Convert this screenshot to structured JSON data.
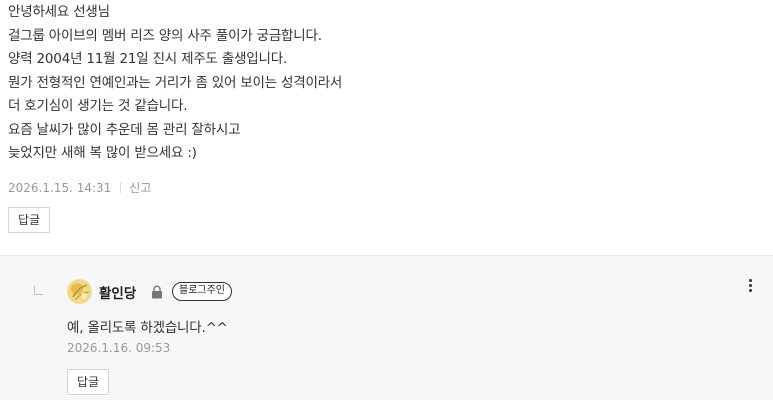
{
  "comment": {
    "lines": [
      "안녕하세요 선생님",
      "걸그룹 아이브의 멤버 리즈 양의 사주 풀이가 궁금합니다.",
      "양력 2004년 11월 21일 진시 제주도 출생입니다.",
      "뭔가 전형적인 연예인과는 거리가 좀 있어 보이는 성격이라서",
      "더 호기심이 생기는 것 같습니다.",
      "요즘 날씨가 많이 추운데 몸 관리 잘하시고",
      "늦었지만 새해 복 많이 받으세요 :)"
    ],
    "date": "2026.1.15. 14:31",
    "report_label": "신고",
    "reply_button": "답글"
  },
  "reply": {
    "author": "활인당",
    "owner_badge": "블로그주인",
    "text": "예, 올리도록 하겠습니다.^^",
    "date": "2026.1.16. 09:53",
    "reply_button": "답글",
    "icons": {
      "avatar": "avatar-image",
      "lock": "lock-icon",
      "menu": "more-vertical-icon",
      "reply_indicator": "reply-arrow-icon"
    }
  },
  "colors": {
    "text": "#333333",
    "meta": "#999999",
    "reply_bg": "#f7f7f7"
  }
}
